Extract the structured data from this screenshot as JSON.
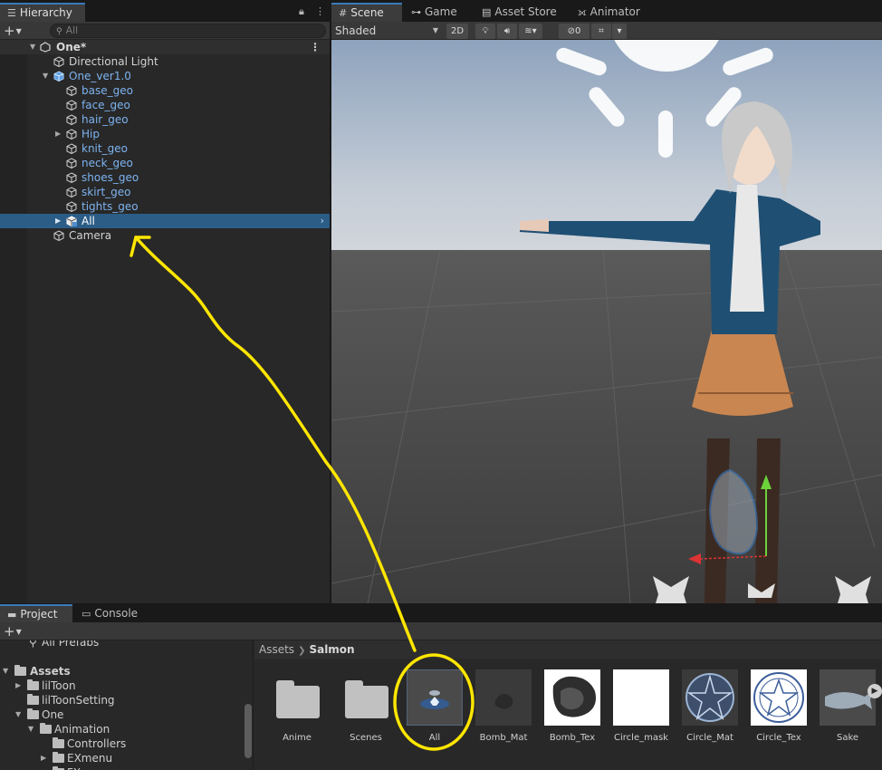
{
  "hierarchy": {
    "tab_label": "Hierarchy",
    "search_placeholder": "All",
    "scene_name": "One*",
    "items": [
      {
        "label": "Directional Light",
        "color": "white"
      },
      {
        "label": "One_ver1.0",
        "color": "blue"
      },
      {
        "label": "base_geo",
        "color": "blue"
      },
      {
        "label": "face_geo",
        "color": "blue"
      },
      {
        "label": "hair_geo",
        "color": "blue"
      },
      {
        "label": "Hip",
        "color": "blue"
      },
      {
        "label": "knit_geo",
        "color": "blue"
      },
      {
        "label": "neck_geo",
        "color": "blue"
      },
      {
        "label": "shoes_geo",
        "color": "blue"
      },
      {
        "label": "skirt_geo",
        "color": "blue"
      },
      {
        "label": "tights_geo",
        "color": "blue"
      },
      {
        "label": "All",
        "color": "white",
        "selected": true
      },
      {
        "label": "Camera",
        "color": "white"
      }
    ]
  },
  "scene_tabs": [
    {
      "label": "Scene",
      "active": true
    },
    {
      "label": "Game"
    },
    {
      "label": "Asset Store"
    },
    {
      "label": "Animator"
    }
  ],
  "scene_toolbar": {
    "shading_mode": "Shaded",
    "mode_2d": "2D",
    "hidden_count": "0"
  },
  "project": {
    "tabs": [
      {
        "label": "Project",
        "active": true
      },
      {
        "label": "Console"
      }
    ],
    "tree": {
      "all_prefabs": "All Prefabs",
      "assets": "Assets",
      "liltoon": "lilToon",
      "liltoon_setting": "lilToonSetting",
      "one": "One",
      "animation": "Animation",
      "controllers": "Controllers",
      "exmenu": "EXmenu",
      "fx": "FX"
    },
    "breadcrumb": {
      "root": "Assets",
      "current": "Salmon"
    },
    "assets": [
      "Anime",
      "Scenes",
      "All",
      "Bomb_Mat",
      "Bomb_Tex",
      "Circle_mask",
      "Circle_Mat",
      "Circle_Tex",
      "Sake"
    ]
  },
  "colors": {
    "selection": "#2c5d87",
    "prefab_blue": "#7db3f0",
    "annotation": "#ffe600",
    "sky": "#bcc6d2",
    "ground": "#464646"
  }
}
